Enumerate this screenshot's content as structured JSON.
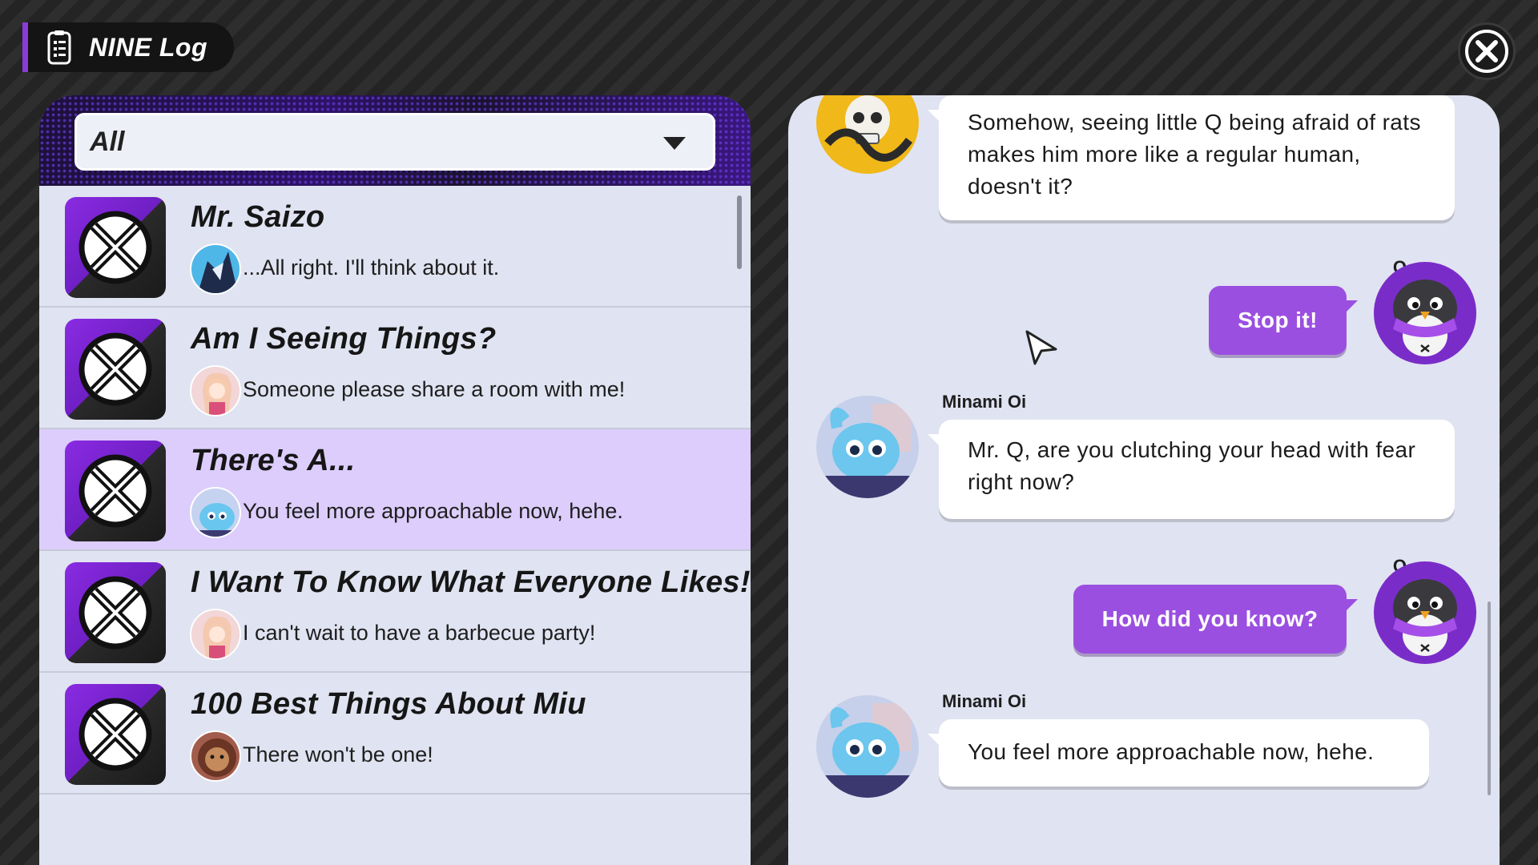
{
  "header": {
    "title": "NINE Log"
  },
  "filter": {
    "selected": "All"
  },
  "threads": [
    {
      "title": "Mr. Saizo",
      "preview": "...All right. I'll think about it.",
      "selected": false
    },
    {
      "title": "Am I Seeing Things?",
      "preview": "Someone please share a room with me!",
      "selected": false
    },
    {
      "title": "There's A...",
      "preview": "You feel more approachable now, hehe.",
      "selected": true
    },
    {
      "title": "I Want To Know What Everyone Likes!",
      "preview": "I can't wait to have a barbecue party!",
      "selected": false
    },
    {
      "title": "100 Best Things About Miu",
      "preview": "There won't be one!",
      "selected": false
    }
  ],
  "chat": [
    {
      "speaker": "",
      "text": "Somehow, seeing little Q being afraid of rats makes him more like a regular human, doesn't it?",
      "from_me": false
    },
    {
      "speaker": "Q",
      "text": "Stop it!",
      "from_me": true
    },
    {
      "speaker": "Minami Oi",
      "text": "Mr. Q, are you clutching your head with fear right now?",
      "from_me": false
    },
    {
      "speaker": "Q",
      "text": "How did you know?",
      "from_me": true
    },
    {
      "speaker": "Minami Oi",
      "text": "You feel more approachable now, hehe.",
      "from_me": false
    }
  ],
  "colors": {
    "accent_purple": "#9b4fe0",
    "selected_row": "#dccdfc",
    "panel_bg": "#e0e3f1"
  },
  "icons": {
    "title": "notepad-icon",
    "close": "close-icon",
    "thread_badge": "x-crossed-circle-icon"
  }
}
